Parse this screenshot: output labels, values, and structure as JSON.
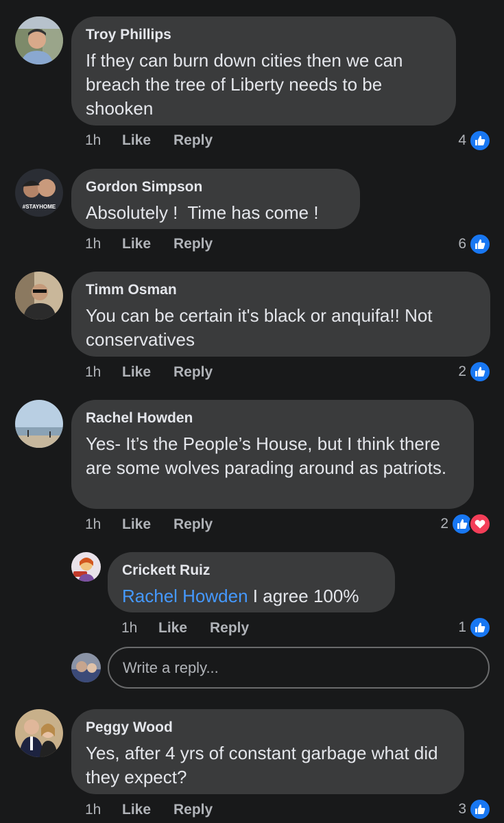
{
  "comments": [
    {
      "author": "Troy Phillips",
      "text": "If they can burn down cities then we can breach the tree of Liberty needs to be shooken",
      "time": "1h",
      "like": "Like",
      "reply": "Reply",
      "reaction_count": "4"
    },
    {
      "author": "Gordon Simpson",
      "text": "Absolutely !  Time has come !",
      "time": "1h",
      "like": "Like",
      "reply": "Reply",
      "reaction_count": "6",
      "avatar_badge": "#STAYHOME"
    },
    {
      "author": "Timm Osman",
      "text": "You can be certain it's black or anquifa!! Not conservatives",
      "time": "1h",
      "like": "Like",
      "reply": "Reply",
      "reaction_count": "2"
    },
    {
      "author": "Rachel Howden",
      "text": "Yes- It’s the People’s House, but I think there are some wolves parading around as patriots.",
      "time": "1h",
      "like": "Like",
      "reply": "Reply",
      "reaction_count": "2"
    },
    {
      "author": "Crickett Ruiz",
      "mention": "Rachel Howden",
      "text": " I agree 100%",
      "time": "1h",
      "like": "Like",
      "reply": "Reply",
      "reaction_count": "1"
    },
    {
      "author": "Peggy Wood",
      "text": "Yes, after 4 yrs of constant garbage what did they expect?",
      "time": "1h",
      "like": "Like",
      "reply": "Reply",
      "reaction_count": "3"
    }
  ],
  "reply_box": {
    "placeholder": "Write a reply..."
  },
  "colors": {
    "background": "#18191a",
    "bubble": "#3a3b3c",
    "like": "#1877f2",
    "love": "#f33e58",
    "mention": "#4599ff"
  },
  "icons": {
    "like": "thumbs-up-icon",
    "love": "heart-icon"
  }
}
